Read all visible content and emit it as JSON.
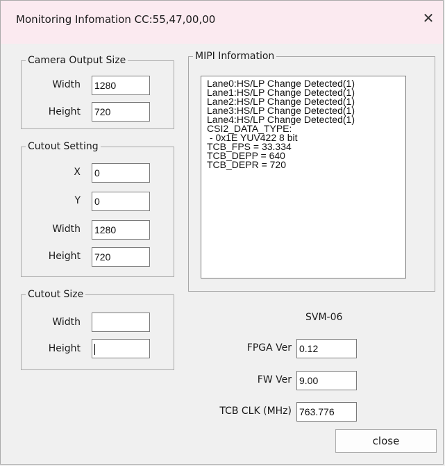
{
  "window": {
    "title": "Monitoring Infomation CC:55,47,00,00",
    "close_glyph": "✕"
  },
  "camera_output_size": {
    "title": "Camera Output Size",
    "width_label": "Width",
    "width_value": "1280",
    "height_label": "Height",
    "height_value": "720"
  },
  "cutout_setting": {
    "title": "Cutout Setting",
    "x_label": "X",
    "x_value": "0",
    "y_label": "Y",
    "y_value": "0",
    "width_label": "Width",
    "width_value": "1280",
    "height_label": "Height",
    "height_value": "720"
  },
  "cutout_size": {
    "title": "Cutout Size",
    "width_label": "Width",
    "width_value": "",
    "height_label": "Height",
    "height_value": ""
  },
  "mipi": {
    "title": "MIPI Information",
    "lines": [
      "Lane0:HS/LP Change Detected(1)",
      "Lane1:HS/LP Change Detected(1)",
      "Lane2:HS/LP Change Detected(1)",
      "Lane3:HS/LP Change Detected(1)",
      "Lane4:HS/LP Change Detected(1)",
      "CSI2_DATA_TYPE:",
      " - 0x1E YUV422 8 bit",
      "TCB_FPS = 33.334",
      "TCB_DEPP = 640",
      "TCB_DEPR = 720"
    ]
  },
  "device": {
    "model": "SVM-06",
    "fpga_label": "FPGA Ver",
    "fpga_value": "0.12",
    "fw_label": "FW Ver",
    "fw_value": "9.00",
    "clk_label": "TCB CLK (MHz)",
    "clk_value": "763.776"
  },
  "buttons": {
    "close_label": "close"
  }
}
